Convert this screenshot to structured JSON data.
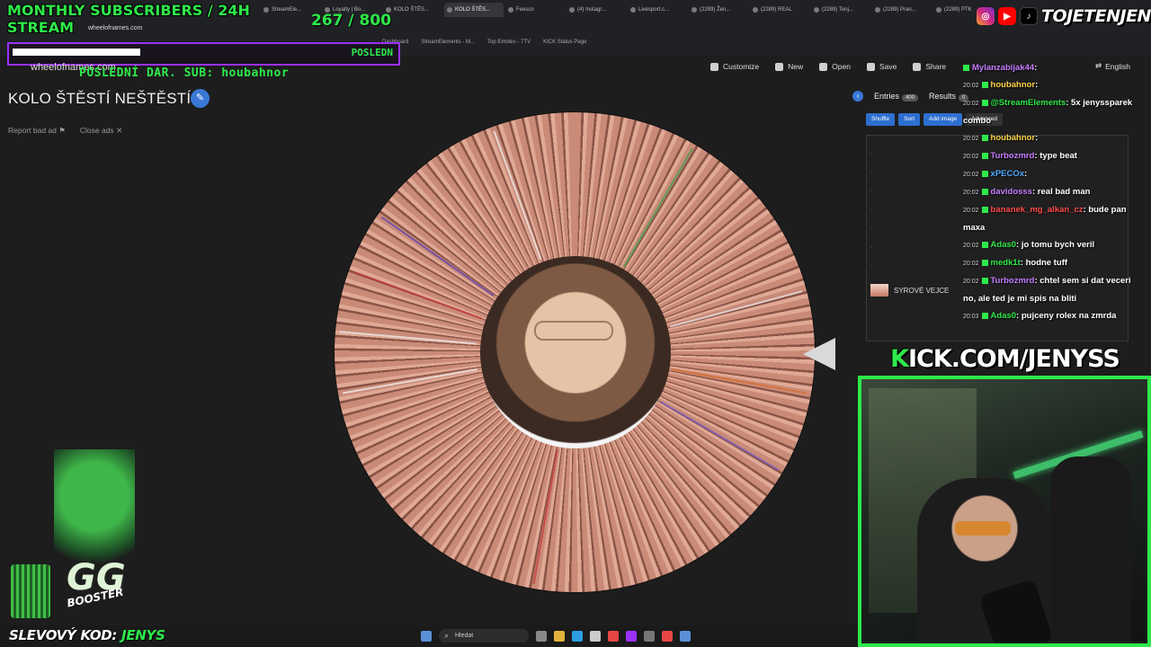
{
  "overlay": {
    "title": "MONTHLY SUBSCRIBERS / 24H STREAM",
    "count": "267 / 800",
    "sub_label": "POSLEDN",
    "ticker": "POSLEDNÍ DAR. SUB: houbahnor",
    "site_name": "wheelofnames.com",
    "social_name": "TOJETENJENYS",
    "kick": "KICK.COM/JENYSS",
    "promo_prefix": "SLEVOVÝ KOD:",
    "promo_code": "JENYS",
    "gg": "GG",
    "booster": "BOOSTER"
  },
  "browser": {
    "url": "wheelofnames.com",
    "tabs": [
      "StreamEle...",
      "Loyalty | Bo...",
      "KOLO ŠTĚS...",
      "KOLO ŠTĚS...",
      "Feesco",
      "(4) Instagr...",
      "Livesport.c...",
      "(2289) Žen...",
      "(2289) REAL",
      "(2289) Tenj...",
      "(2289) Pran...",
      "(2289) PTK"
    ],
    "bookmarks": [
      "Dashboard",
      "StreamElements - M...",
      "Top Emotes - 7TV",
      "KICK Status Page"
    ]
  },
  "toolbar": {
    "customize": "Customize",
    "new": "New",
    "open": "Open",
    "save": "Save",
    "share": "Share",
    "language": "English"
  },
  "page": {
    "title": "KOLO ŠTĚSTÍ NEŠTĚSTÍ",
    "report_ad": "Report bad ad",
    "close_ads": "Close ads"
  },
  "entries": {
    "tab_entries": "Entries",
    "entries_count": "400",
    "tab_results": "Results",
    "results_count": "0",
    "shuffle": "Shuffle",
    "sort": "Sort",
    "add_image": "Add image",
    "advanced": "Advanced",
    "visible_entry": "SYROVÉ VEJCE"
  },
  "chat": [
    {
      "time": "",
      "user": "Mylanzabijak44",
      "color": "#c77dff",
      "text": ":"
    },
    {
      "time": "20:02",
      "user": "houbahnor",
      "color": "#ffd54a",
      "text": ":"
    },
    {
      "time": "20:02",
      "user": "@StreamElements",
      "color": "#2ee94a",
      "text": ": 5x jenyssparek combo"
    },
    {
      "time": "20:02",
      "user": "houbahnor",
      "color": "#ffd54a",
      "text": ":"
    },
    {
      "time": "20:02",
      "user": "Turbozmrd",
      "color": "#c77dff",
      "text": ": type beat"
    },
    {
      "time": "20:02",
      "user": "xPECOx",
      "color": "#4dabff",
      "text": ":"
    },
    {
      "time": "20:02",
      "user": "davidosss",
      "color": "#c77dff",
      "text": ": real bad man"
    },
    {
      "time": "20:02",
      "user": "bananek_mg_alkan_cz",
      "color": "#ff4d4d",
      "text": ": bude pan maxa"
    },
    {
      "time": "20:02",
      "user": "Adas0",
      "color": "#2ee94a",
      "text": ": jo tomu bych veril"
    },
    {
      "time": "20:02",
      "user": "medk1t",
      "color": "#2ee94a",
      "text": ": hodne tuff"
    },
    {
      "time": "20:02",
      "user": "Turbozmrd",
      "color": "#c77dff",
      "text": ": chtel sem si dat veceri no, ale ted je mi spis na bliti"
    },
    {
      "time": "20:03",
      "user": "Adas0",
      "color": "#2ee94a",
      "text": ": pujceny rolex na zmrda"
    }
  ],
  "taskbar": {
    "search": "Hledat"
  },
  "colors": {
    "accent_green": "#2ee94a",
    "accent_purple": "#9b30ff",
    "button_blue": "#3a78d6"
  }
}
